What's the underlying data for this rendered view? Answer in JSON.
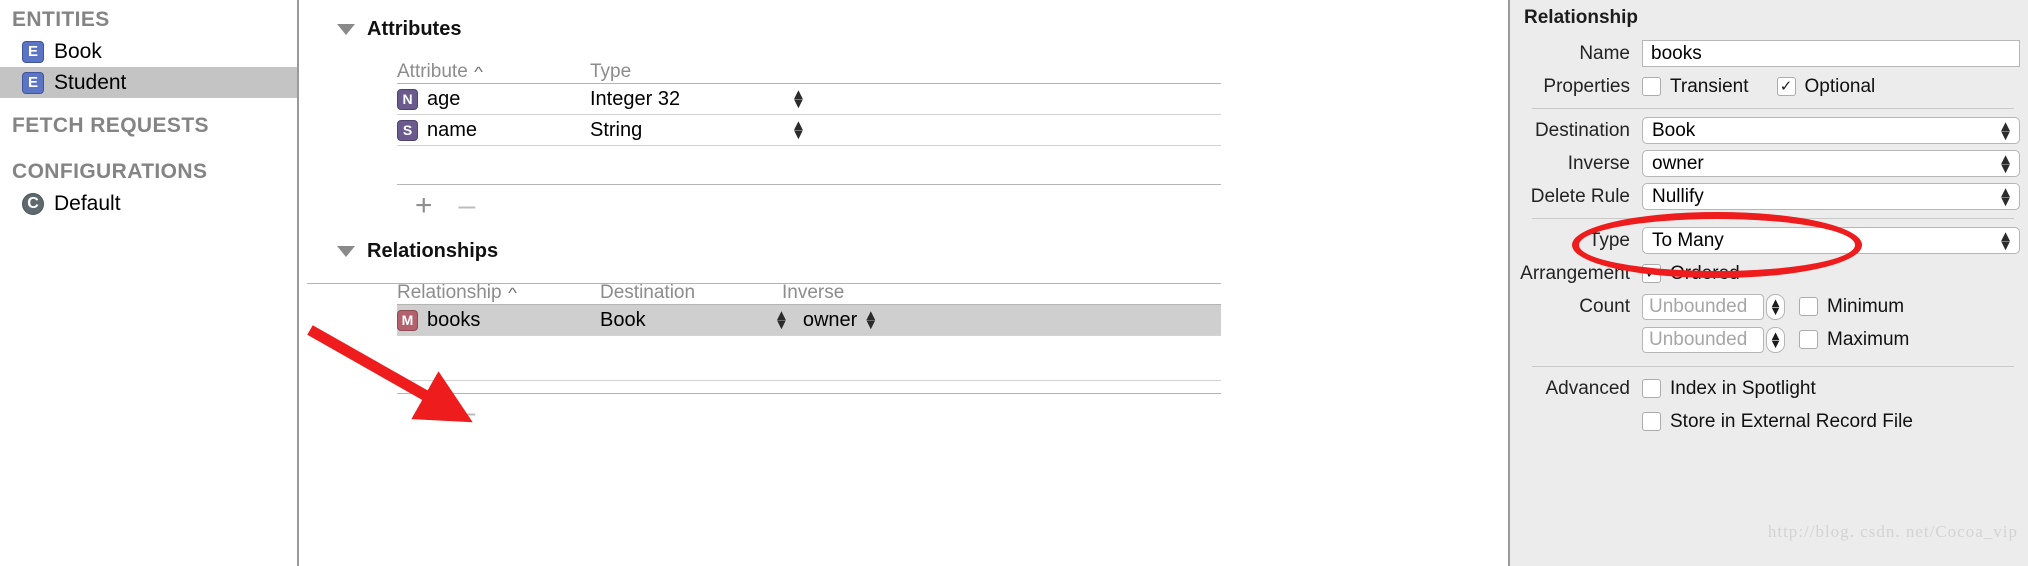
{
  "sidebar": {
    "groups": [
      {
        "header": "ENTITIES",
        "items": [
          {
            "icon": "entity-icon",
            "badge": "E",
            "label": "Book",
            "selected": false
          },
          {
            "icon": "entity-icon",
            "badge": "E",
            "label": "Student",
            "selected": true
          }
        ]
      },
      {
        "header": "FETCH REQUESTS",
        "items": []
      },
      {
        "header": "CONFIGURATIONS",
        "items": [
          {
            "icon": "configuration-icon",
            "badge": "C",
            "label": "Default",
            "selected": false
          }
        ]
      }
    ]
  },
  "editor": {
    "attributes": {
      "title": "Attributes",
      "columns": [
        "Attribute",
        "Type"
      ],
      "sort_column": "Attribute",
      "sort_caret": "^",
      "rows": [
        {
          "badge": "N",
          "name": "age",
          "type": "Integer 32"
        },
        {
          "badge": "S",
          "name": "name",
          "type": "String"
        }
      ],
      "add_label": "+",
      "remove_label": "–"
    },
    "relationships": {
      "title": "Relationships",
      "columns": [
        "Relationship",
        "Destination",
        "Inverse"
      ],
      "sort_column": "Relationship",
      "sort_caret": "^",
      "rows": [
        {
          "badge": "M",
          "name": "books",
          "destination": "Book",
          "inverse": "owner",
          "selected": true
        }
      ],
      "add_label": "+",
      "remove_label": "–"
    }
  },
  "inspector": {
    "title": "Relationship",
    "name_label": "Name",
    "name_value": "books",
    "properties_label": "Properties",
    "transient_label": "Transient",
    "transient_checked": false,
    "optional_label": "Optional",
    "optional_checked": true,
    "destination_label": "Destination",
    "destination_value": "Book",
    "inverse_label": "Inverse",
    "inverse_value": "owner",
    "delete_rule_label": "Delete Rule",
    "delete_rule_value": "Nullify",
    "type_label": "Type",
    "type_value": "To Many",
    "arrangement_label": "Arrangement",
    "ordered_label": "Ordered",
    "ordered_checked": true,
    "count_label": "Count",
    "count_min_placeholder": "Unbounded",
    "count_max_placeholder": "Unbounded",
    "minimum_label": "Minimum",
    "minimum_checked": false,
    "maximum_label": "Maximum",
    "maximum_checked": false,
    "advanced_label": "Advanced",
    "index_spotlight_label": "Index in Spotlight",
    "index_spotlight_checked": false,
    "external_record_label": "Store in External Record File",
    "external_record_checked": false,
    "watermark": "http://blog. csdn. net/Cocoa_vip"
  },
  "annotations": {
    "highlight_color": "#ee1c1c",
    "ellipse_target": "To Many / Ordered",
    "arrow_target": "add-relationship-button"
  }
}
